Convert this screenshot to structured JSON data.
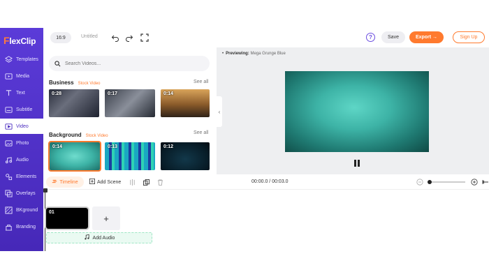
{
  "app": {
    "logo_prefix": "F",
    "logo_rest": "lexClip"
  },
  "sidebar": {
    "items": [
      {
        "label": "Templates",
        "icon": "layers-icon"
      },
      {
        "label": "Media",
        "icon": "media-icon"
      },
      {
        "label": "Text",
        "icon": "text-icon"
      },
      {
        "label": "Subtitle",
        "icon": "subtitle-icon"
      },
      {
        "label": "Video",
        "icon": "video-icon",
        "active": true
      },
      {
        "label": "Photo",
        "icon": "photo-icon"
      },
      {
        "label": "Audio",
        "icon": "audio-icon"
      },
      {
        "label": "Elements",
        "icon": "elements-icon"
      },
      {
        "label": "Overlays",
        "icon": "overlays-icon"
      },
      {
        "label": "BKground",
        "icon": "background-icon"
      },
      {
        "label": "Branding",
        "icon": "branding-icon"
      }
    ]
  },
  "topbar": {
    "ratio": "16:9",
    "title": "Untitled",
    "help": "?",
    "save": "Save",
    "export": "Export →",
    "signup": "Sign Up"
  },
  "panel": {
    "search_placeholder": "Search Videos...",
    "sections": [
      {
        "title": "Business",
        "badge": "Stock Video",
        "see_all": "See all",
        "thumbs": [
          {
            "duration": "0:28"
          },
          {
            "duration": "0:17"
          },
          {
            "duration": "0:14"
          }
        ]
      },
      {
        "title": "Background",
        "badge": "Stock Video",
        "see_all": "See all",
        "thumbs": [
          {
            "duration": "0:14"
          },
          {
            "duration": "0:13"
          },
          {
            "duration": "0:12"
          }
        ]
      }
    ]
  },
  "preview": {
    "label_prefix": "Previewing:",
    "label_name": "Mega Grunge Blue"
  },
  "timeline": {
    "tab": "Timeline",
    "add_scene": "Add Scene",
    "time": "00:00.0 / 00:03.0",
    "clip_number": "01",
    "add_clip": "+",
    "add_audio": "Add Audio",
    "zoom_level": 0
  },
  "colors": {
    "brand_purple": "#4f30c8",
    "accent_orange": "#ff7a2e",
    "video_teal": "#3db3a6"
  }
}
